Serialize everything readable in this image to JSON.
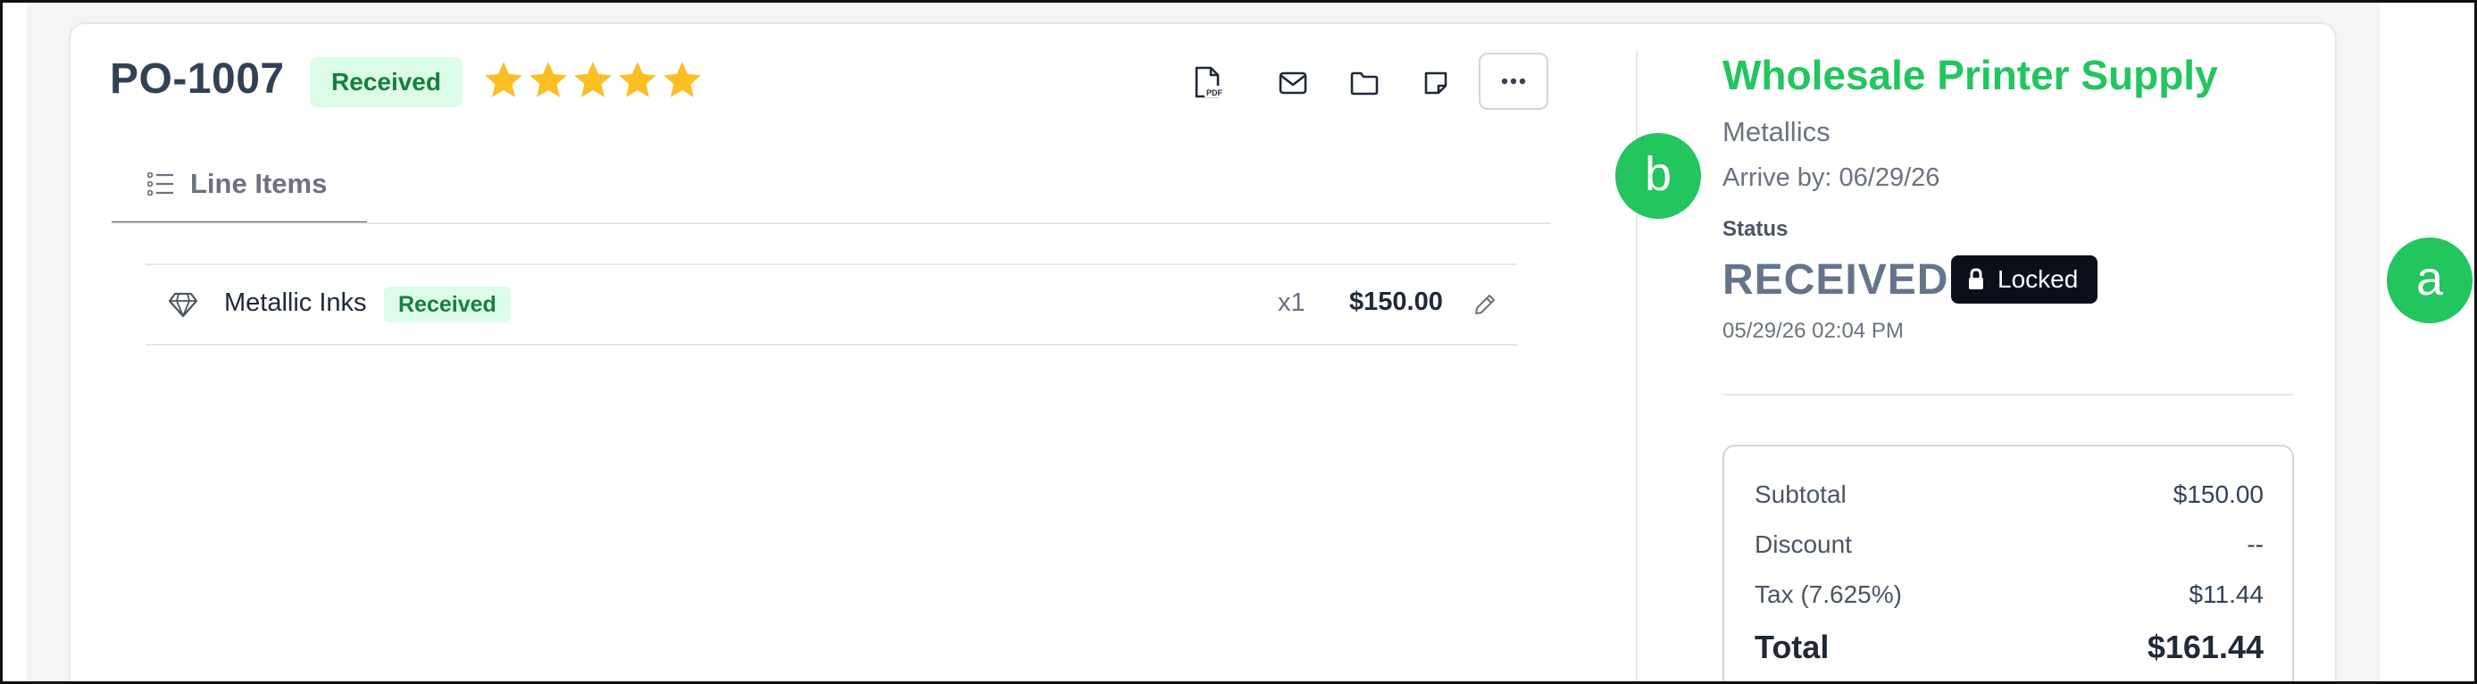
{
  "header": {
    "po_number": "PO-1007",
    "status_badge": "Received",
    "rating": {
      "value": 5,
      "max": 5
    }
  },
  "toolbar": {
    "icons": [
      "pdf-icon",
      "mail-icon",
      "folder-icon",
      "note-icon",
      "more-icon"
    ]
  },
  "tabs": [
    {
      "label": "Line Items",
      "icon": "list-icon",
      "active": true
    }
  ],
  "line_items": [
    {
      "name": "Metallic Inks",
      "status": "Received",
      "qty": "x1",
      "price": "$150.00",
      "icon": "gem-icon"
    }
  ],
  "vendor": {
    "name": "Wholesale Printer Supply",
    "category": "Metallics",
    "arrive_by": "Arrive by: 06/29/26"
  },
  "status": {
    "label": "Status",
    "value": "RECEIVED",
    "locked_label": "Locked",
    "timestamp": "05/29/26 02:04 PM"
  },
  "totals": {
    "subtotal_label": "Subtotal",
    "subtotal": "$150.00",
    "discount_label": "Discount",
    "discount": "--",
    "tax_label": "Tax (7.625%)",
    "tax": "$11.44",
    "total_label": "Total",
    "total": "$161.44"
  },
  "markers": {
    "a": "a",
    "b": "b"
  },
  "colors": {
    "accent_green": "#22c55e",
    "badge_bg": "#dcfce7",
    "badge_text": "#15803d",
    "star": "#fbbf24",
    "locked_bg": "#0b0f19"
  }
}
